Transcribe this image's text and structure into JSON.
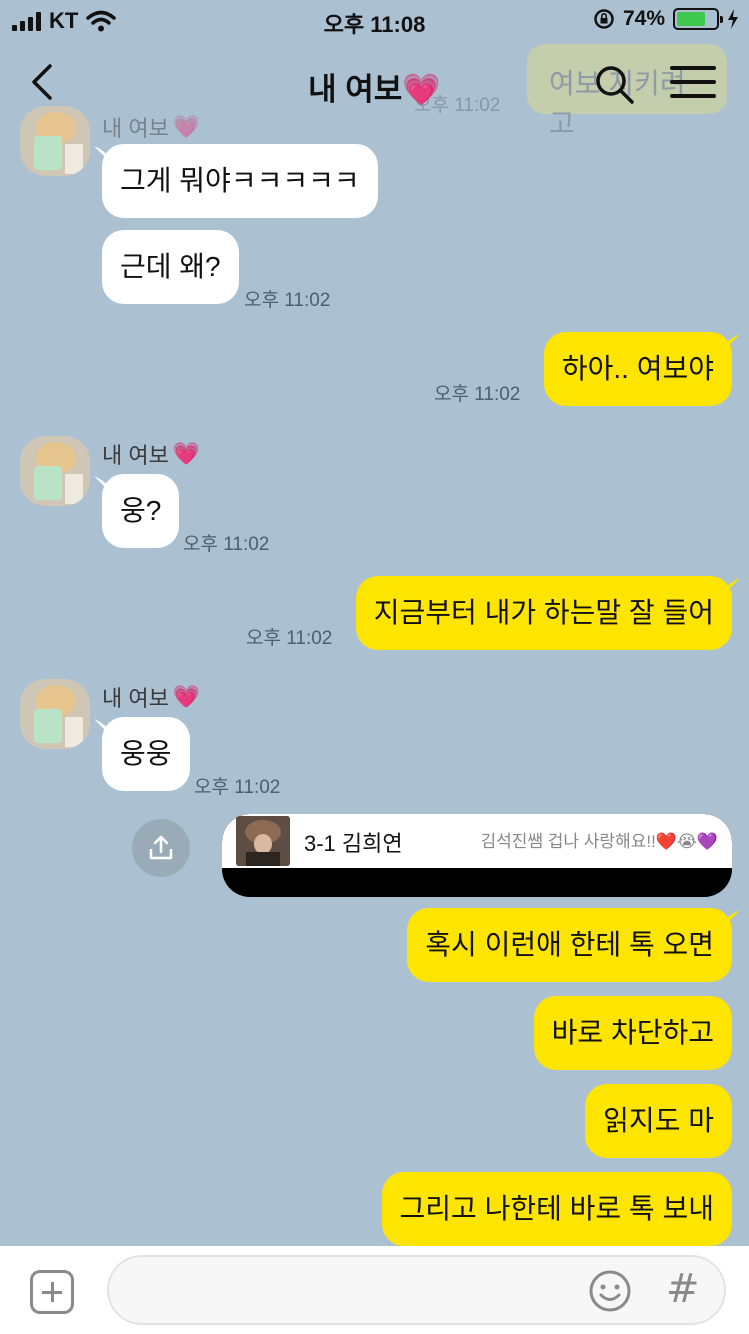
{
  "status_bar": {
    "carrier": "KT",
    "time": "오후 11:08",
    "battery": "74%",
    "battery_level": 0.74
  },
  "header": {
    "title": "내 여보",
    "title_emoji": "💗",
    "ghost_message": "여보 지키려고",
    "ghost_time": "오후 11:02"
  },
  "contact": {
    "name": "내 여보",
    "emoji": "💗"
  },
  "messages": [
    {
      "dir": "in",
      "text": "그게 뭐야ㅋㅋㅋㅋㅋ"
    },
    {
      "dir": "in",
      "text": "근데 왜?",
      "time": "오후 11:02"
    },
    {
      "dir": "out",
      "text": "하아.. 여보야",
      "time": "오후 11:02"
    },
    {
      "dir": "in",
      "text": "웅?",
      "time": "오후 11:02"
    },
    {
      "dir": "out",
      "text": "지금부터 내가 하는말 잘 들어",
      "time": "오후 11:02"
    },
    {
      "dir": "in",
      "text": "웅웅",
      "time": "오후 11:02"
    },
    {
      "dir": "out",
      "text": "혹시 이런애 한테 톡 오면"
    },
    {
      "dir": "out",
      "text": "바로 차단하고"
    },
    {
      "dir": "out",
      "text": "읽지도 마"
    },
    {
      "dir": "out",
      "text": "그리고 나한테 바로 톡 보내"
    }
  ],
  "shared_profile": {
    "name": "3-1 김희연",
    "status": "김석진쌤 겁나 사랑해요!!❤️😭💜"
  },
  "input": {
    "value": "",
    "placeholder": ""
  },
  "icons": {
    "back": "back-arrow-icon",
    "search": "search-icon",
    "menu": "menu-icon",
    "share": "share-icon",
    "plus": "plus-icon",
    "emoji": "emoji-icon",
    "hash": "hash-icon"
  }
}
